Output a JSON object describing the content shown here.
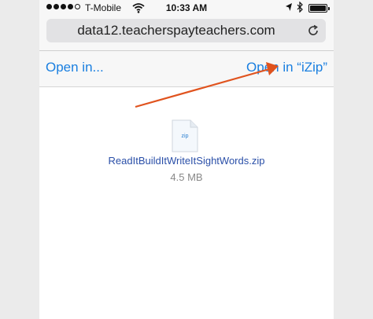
{
  "status_bar": {
    "carrier": "T-Mobile",
    "time": "10:33 AM",
    "signal_bars_filled": 4,
    "signal_bars_total": 5,
    "battery_level": 1.0
  },
  "address_bar": {
    "url": "data12.teacherspayteachers.com",
    "reload_icon": "reload-icon"
  },
  "toolbar": {
    "open_in_label": "Open in...",
    "open_in_app_label": "Open in “iZip”"
  },
  "annotation": {
    "arrow_icon": "arrow-icon",
    "arrow_color": "#e0531e"
  },
  "file": {
    "icon_label": "zip",
    "name": "ReadItBuildItWriteItSightWords.zip",
    "size": "4.5 MB"
  },
  "colors": {
    "link_blue": "#1a7fe0",
    "filename_blue": "#2a4fa8"
  }
}
